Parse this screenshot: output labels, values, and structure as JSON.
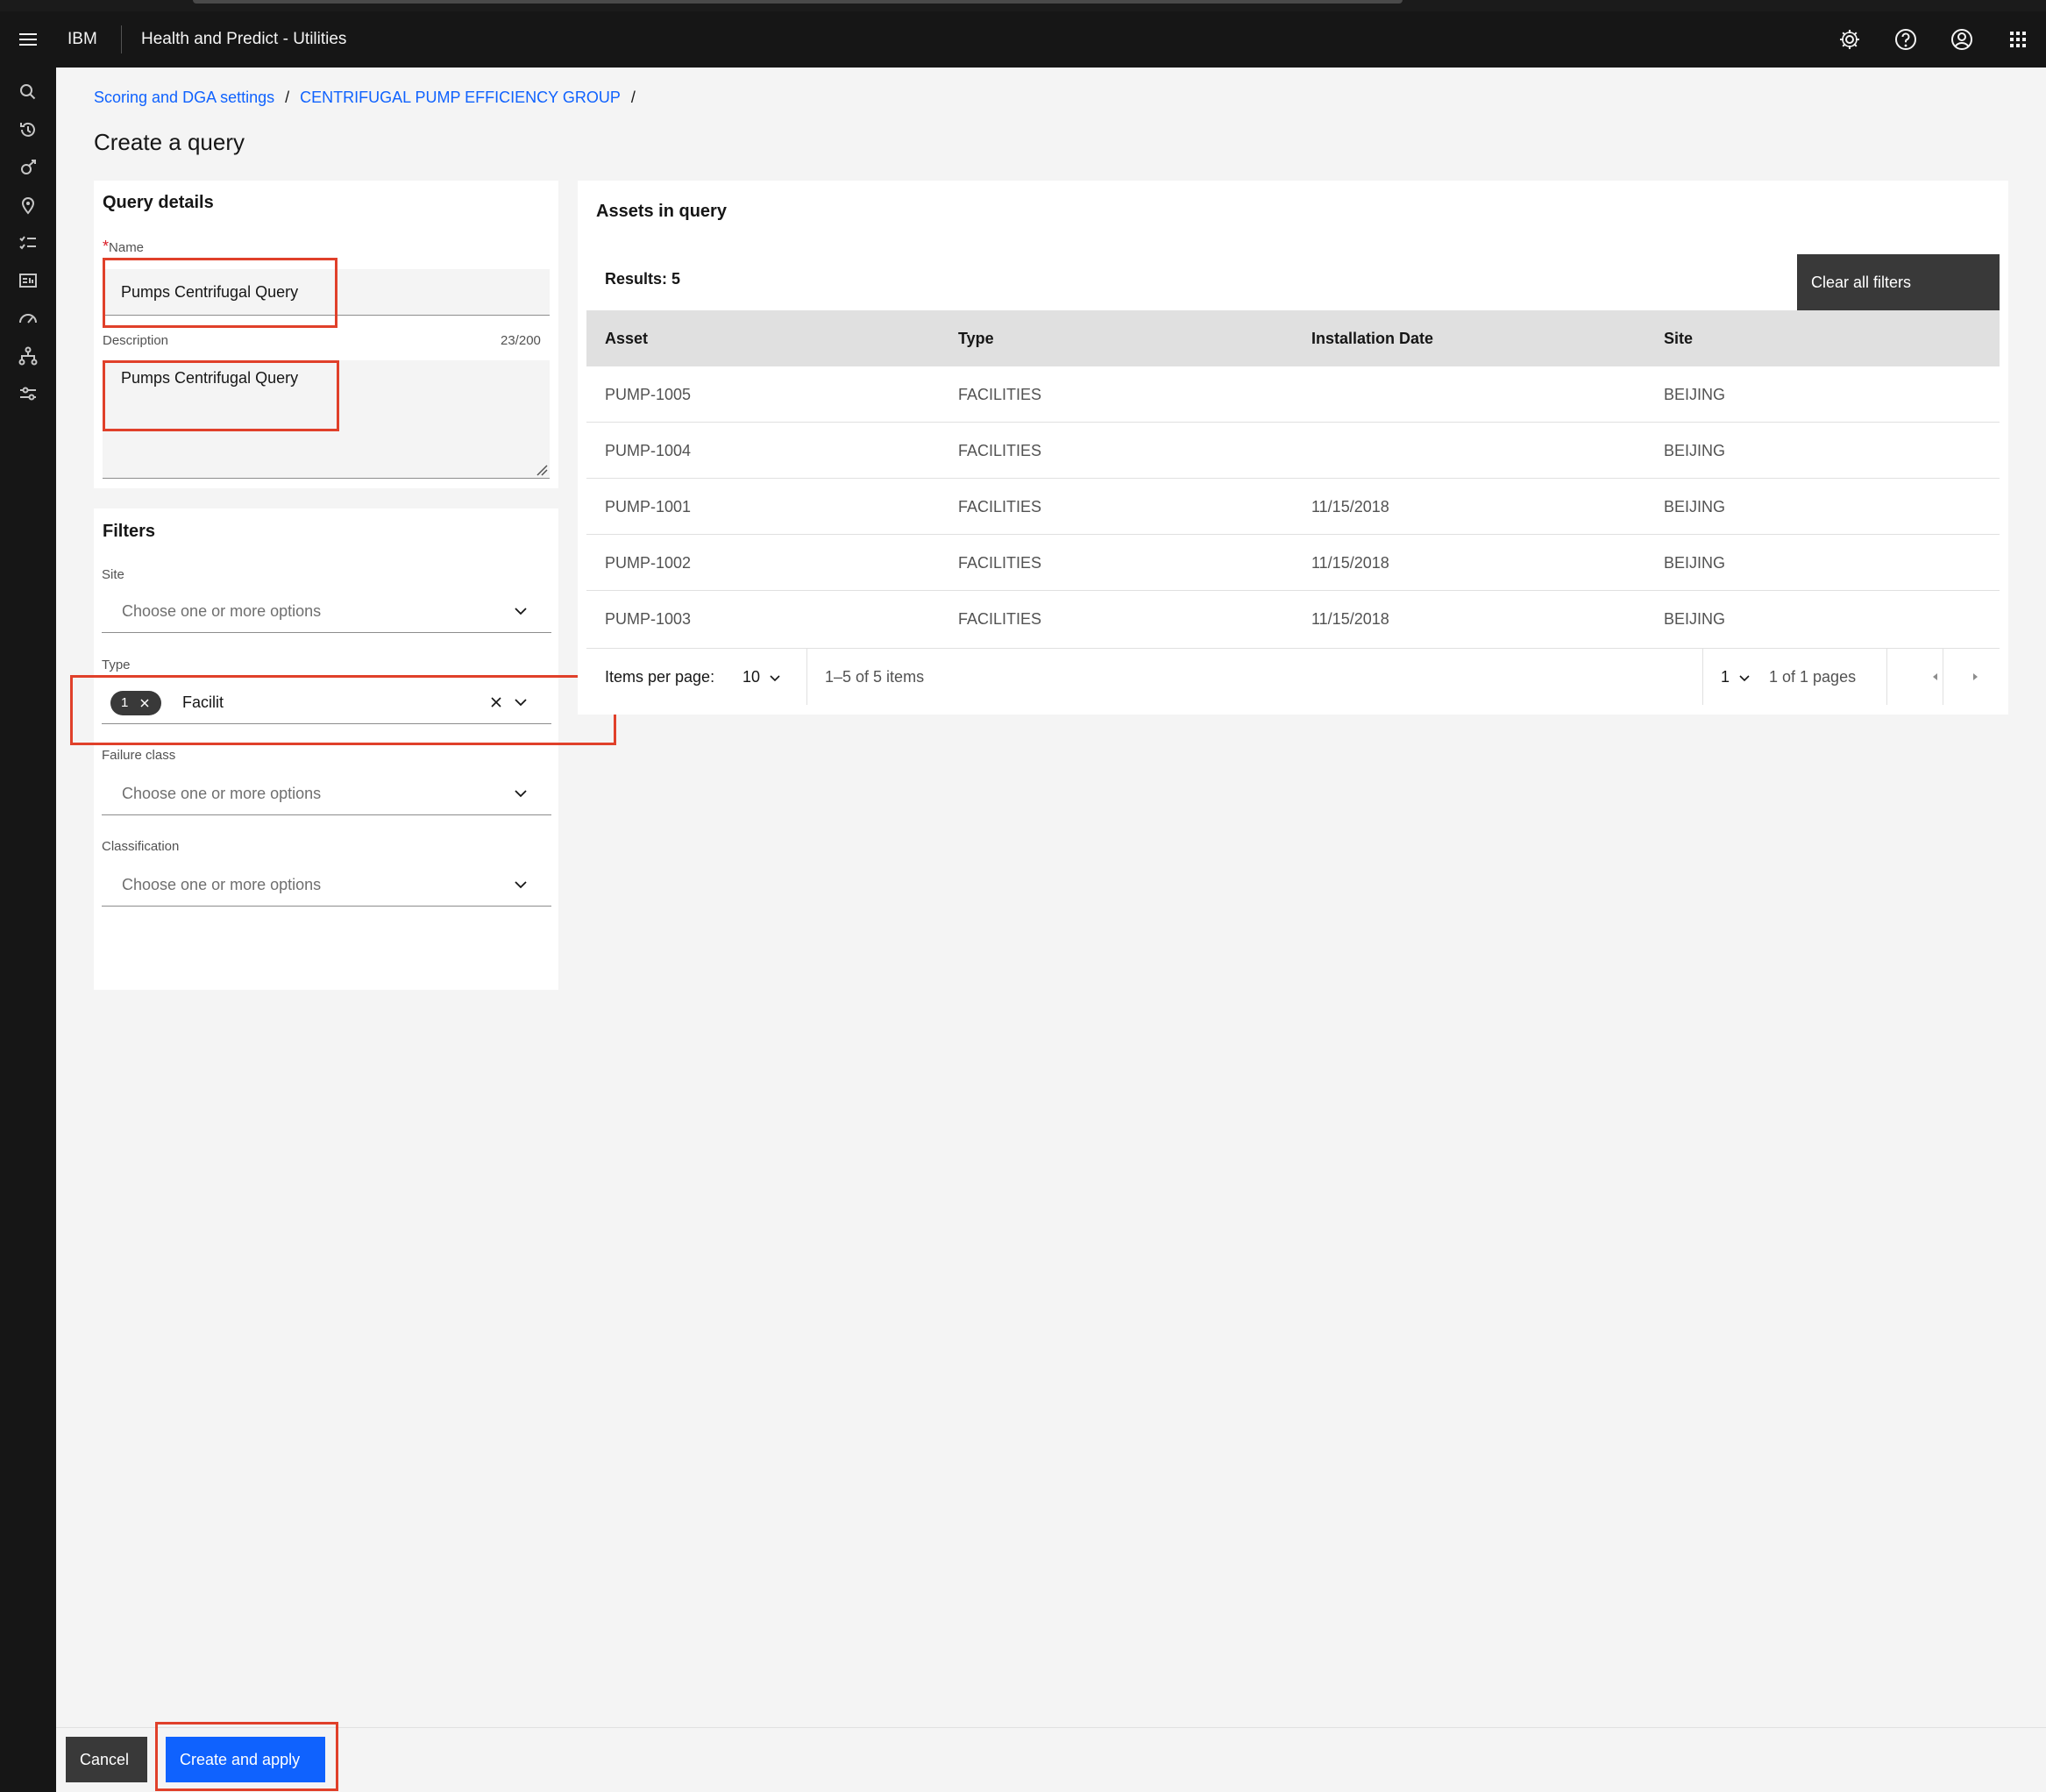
{
  "header": {
    "brand": "IBM",
    "app_name": "Health and Predict - Utilities"
  },
  "breadcrumb": {
    "items": [
      "Scoring and DGA settings",
      "CENTRIFUGAL PUMP EFFICIENCY GROUP"
    ],
    "separator": "/"
  },
  "page_title": "Create a query",
  "query_details": {
    "title": "Query details",
    "required_mark": "*",
    "name_label": "Name",
    "name_value": "Pumps Centrifugal Query",
    "description_label": "Description",
    "description_counter": "23/200",
    "description_value": "Pumps Centrifugal Query"
  },
  "filters": {
    "title": "Filters",
    "site": {
      "label": "Site",
      "placeholder": "Choose one or more options"
    },
    "type": {
      "label": "Type",
      "tag_count": "1",
      "value": "Facilit"
    },
    "failure_class": {
      "label": "Failure class",
      "placeholder": "Choose one or more options"
    },
    "classification": {
      "label": "Classification",
      "placeholder": "Choose one or more options"
    }
  },
  "assets": {
    "title": "Assets in query",
    "results": "Results: 5",
    "clear_filters": "Clear all filters",
    "columns": [
      "Asset",
      "Type",
      "Installation Date",
      "Site"
    ],
    "rows": [
      [
        "PUMP-1005",
        "FACILITIES",
        "",
        "BEIJING"
      ],
      [
        "PUMP-1004",
        "FACILITIES",
        "",
        "BEIJING"
      ],
      [
        "PUMP-1001",
        "FACILITIES",
        "11/15/2018",
        "BEIJING"
      ],
      [
        "PUMP-1002",
        "FACILITIES",
        "11/15/2018",
        "BEIJING"
      ],
      [
        "PUMP-1003",
        "FACILITIES",
        "11/15/2018",
        "BEIJING"
      ]
    ],
    "pagination": {
      "items_per_page_label": "Items per page:",
      "items_per_page": "10",
      "range": "1–5 of 5 items",
      "page": "1",
      "pages": "1 of 1 pages"
    }
  },
  "footer": {
    "cancel": "Cancel",
    "create": "Create and apply"
  },
  "icons": {
    "header": [
      "settings-icon",
      "help-icon",
      "user-avatar-icon",
      "app-switcher-icon"
    ],
    "sidenav": [
      "search-icon",
      "history-icon",
      "asset-icon",
      "location-icon",
      "checklist-icon",
      "dashboard-icon",
      "gauge-icon",
      "hierarchy-icon",
      "settings-sliders-icon"
    ]
  },
  "colors": {
    "header_bg": "#161616",
    "link": "#0f62fe",
    "primary_button": "#0f62fe",
    "secondary_button": "#393939",
    "annotation_red": "#e0402a",
    "page_bg": "#f4f4f4"
  }
}
